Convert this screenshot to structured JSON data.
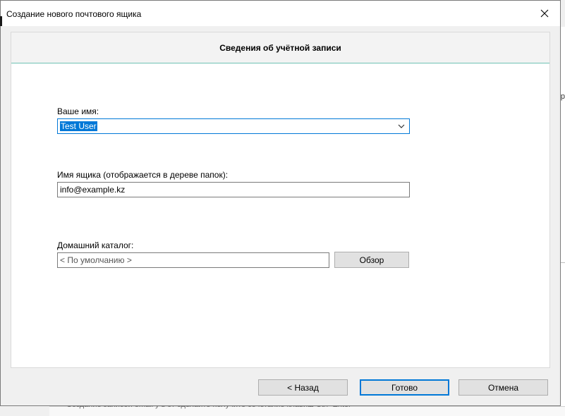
{
  "window": {
    "title": "Создание нового почтового ящика"
  },
  "panel": {
    "header": "Сведения об учётной записи"
  },
  "form": {
    "name_label": "Ваше имя:",
    "name_value": "Test User",
    "mailbox_label": "Имя ящика (отображается в дереве папок):",
    "mailbox_value": "info@example.kz",
    "home_label": "Домашний каталог:",
    "home_value": "< По умолчанию >",
    "browse_label": "Обзор"
  },
  "buttons": {
    "back": "<  Назад",
    "finish": "Готово",
    "cancel": "Отмена"
  },
  "background": {
    "right_text": "ер",
    "bottom_text": "Создание  записей  email  у  в  эт  сделайте  получите  сочетание  клавиш  Ctrl+Enter"
  },
  "colors": {
    "accent": "#0078d7",
    "header_underline": "#6ec1b4"
  }
}
